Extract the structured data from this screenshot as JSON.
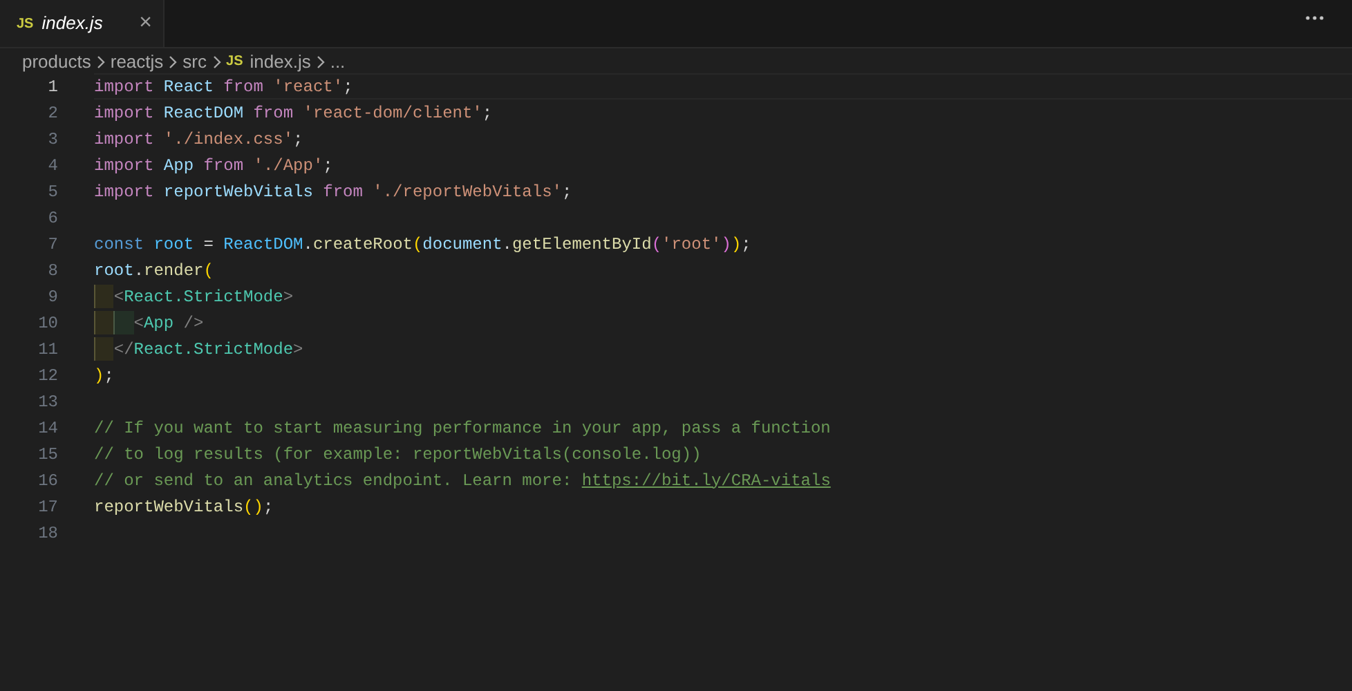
{
  "tabs": [
    {
      "icon_text": "JS",
      "title": "index.js",
      "close": "×",
      "selected": true
    }
  ],
  "breadcrumbs": [
    {
      "label": "products"
    },
    {
      "label": "reactjs"
    },
    {
      "label": "src"
    },
    {
      "icon_text": "JS",
      "label": "index.js"
    },
    {
      "label": "..."
    }
  ],
  "code_lines": [
    {
      "number": "1",
      "current": true,
      "tokens": [
        {
          "text": "import ",
          "kind": "keyword"
        },
        {
          "text": "React ",
          "kind": "var"
        },
        {
          "text": "from ",
          "kind": "keyword"
        },
        {
          "text": "'react'",
          "kind": "string"
        },
        {
          "text": ";",
          "kind": "plain"
        }
      ]
    },
    {
      "number": "2",
      "current": false,
      "tokens": [
        {
          "text": "import ",
          "kind": "keyword"
        },
        {
          "text": "ReactDOM ",
          "kind": "var"
        },
        {
          "text": "from ",
          "kind": "keyword"
        },
        {
          "text": "'react-dom/client'",
          "kind": "string"
        },
        {
          "text": ";",
          "kind": "plain"
        }
      ]
    },
    {
      "number": "3",
      "current": false,
      "tokens": [
        {
          "text": "import ",
          "kind": "keyword"
        },
        {
          "text": "'./index.css'",
          "kind": "string"
        },
        {
          "text": ";",
          "kind": "plain"
        }
      ]
    },
    {
      "number": "4",
      "current": false,
      "tokens": [
        {
          "text": "import ",
          "kind": "keyword"
        },
        {
          "text": "App ",
          "kind": "var"
        },
        {
          "text": "from ",
          "kind": "keyword"
        },
        {
          "text": "'./App'",
          "kind": "string"
        },
        {
          "text": ";",
          "kind": "plain"
        }
      ]
    },
    {
      "number": "5",
      "current": false,
      "tokens": [
        {
          "text": "import ",
          "kind": "keyword"
        },
        {
          "text": "reportWebVitals ",
          "kind": "var"
        },
        {
          "text": "from ",
          "kind": "keyword"
        },
        {
          "text": "'./reportWebVitals'",
          "kind": "string"
        },
        {
          "text": ";",
          "kind": "plain"
        }
      ]
    },
    {
      "number": "6",
      "current": false
    },
    {
      "number": "7",
      "current": false,
      "tokens": [
        {
          "text": "const ",
          "kind": "storage"
        },
        {
          "text": "root",
          "kind": "constant"
        },
        {
          "text": " = ",
          "kind": "plain"
        },
        {
          "text": "ReactDOM",
          "kind": "constant"
        },
        {
          "text": ".",
          "kind": "plain"
        },
        {
          "text": "createRoot",
          "kind": "function"
        },
        {
          "text": "(",
          "kind": "bracket1"
        },
        {
          "text": "document",
          "kind": "var"
        },
        {
          "text": ".",
          "kind": "plain"
        },
        {
          "text": "getElementById",
          "kind": "function"
        },
        {
          "text": "(",
          "kind": "bracket2"
        },
        {
          "text": "'root'",
          "kind": "string"
        },
        {
          "text": ")",
          "kind": "bracket2"
        },
        {
          "text": ")",
          "kind": "bracket1"
        },
        {
          "text": ";",
          "kind": "plain"
        }
      ]
    },
    {
      "number": "8",
      "current": false,
      "tokens": [
        {
          "text": "root",
          "kind": "var"
        },
        {
          "text": ".",
          "kind": "plain"
        },
        {
          "text": "render",
          "kind": "function"
        },
        {
          "text": "(",
          "kind": "bracket1"
        }
      ]
    },
    {
      "number": "9",
      "current": false,
      "tokens": [
        {
          "text": "  <",
          "kind": "tagpunct"
        },
        {
          "text": "React.StrictMode",
          "kind": "tag"
        },
        {
          "text": ">",
          "kind": "tagpunct"
        }
      ]
    },
    {
      "number": "10",
      "current": false,
      "tokens": [
        {
          "text": "    <",
          "kind": "tagpunct"
        },
        {
          "text": "App",
          "kind": "tag"
        },
        {
          "text": " />",
          "kind": "tagpunct"
        }
      ]
    },
    {
      "number": "11",
      "current": false,
      "tokens": [
        {
          "text": "  </",
          "kind": "tagpunct"
        },
        {
          "text": "React.StrictMode",
          "kind": "tag"
        },
        {
          "text": ">",
          "kind": "tagpunct"
        }
      ]
    },
    {
      "number": "12",
      "current": false,
      "tokens": [
        {
          "text": ")",
          "kind": "bracket1"
        },
        {
          "text": ";",
          "kind": "plain"
        }
      ]
    },
    {
      "number": "13",
      "current": false
    },
    {
      "number": "14",
      "current": false,
      "tokens": [
        {
          "text": "// If you want to start measuring performance in your app, pass a function",
          "kind": "comment"
        }
      ]
    },
    {
      "number": "15",
      "current": false,
      "tokens": [
        {
          "text": "// to log results (for example: reportWebVitals(console.log))",
          "kind": "comment"
        }
      ]
    },
    {
      "number": "16",
      "current": false,
      "tokens": [
        {
          "text": "// or send to an analytics endpoint. Learn more: ",
          "kind": "comment"
        },
        {
          "text": "https://bit.ly/CRA-vitals",
          "kind": "link"
        }
      ]
    },
    {
      "number": "17",
      "current": false,
      "tokens": [
        {
          "text": "reportWebVitals",
          "kind": "function"
        },
        {
          "text": "(",
          "kind": "bracket1"
        },
        {
          "text": ")",
          "kind": "bracket1"
        },
        {
          "text": ";",
          "kind": "plain"
        }
      ]
    },
    {
      "number": "18",
      "current": false
    }
  ]
}
